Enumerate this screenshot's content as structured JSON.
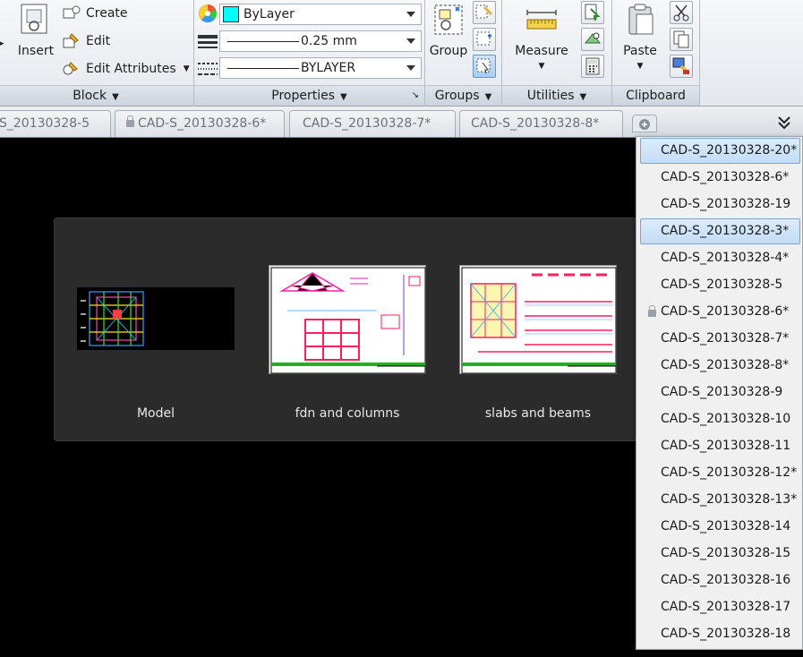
{
  "ribbon": {
    "block": {
      "title": "Block",
      "insert_label": "Insert",
      "create_label": "Create",
      "edit_label": "Edit",
      "edit_attributes_label": "Edit Attributes"
    },
    "properties": {
      "title": "Properties",
      "color_value": "ByLayer",
      "color_swatch": "#00ffff",
      "lineweight_value": "0.25 mm",
      "linetype_value": "BYLAYER"
    },
    "groups": {
      "title": "Groups",
      "group_label": "Group"
    },
    "utilities": {
      "title": "Utilities",
      "measure_label": "Measure"
    },
    "clipboard": {
      "title": "Clipboard",
      "paste_label": "Paste"
    }
  },
  "tabs": [
    {
      "label": "S_20130328-5",
      "locked": false
    },
    {
      "label": "CAD-S_20130328-6*",
      "locked": true
    },
    {
      "label": "CAD-S_20130328-7*",
      "locked": false
    },
    {
      "label": "CAD-S_20130328-8*",
      "locked": false
    }
  ],
  "layout_preview": {
    "items": [
      {
        "label": "Model"
      },
      {
        "label": "fdn and columns"
      },
      {
        "label": "slabs and beams"
      }
    ]
  },
  "drawing_list": {
    "items": [
      {
        "label": "CAD-S_20130328-20*",
        "highlighted": true,
        "locked": false
      },
      {
        "label": "CAD-S_20130328-6*",
        "highlighted": false,
        "locked": false
      },
      {
        "label": "CAD-S_20130328-19",
        "highlighted": false,
        "locked": false
      },
      {
        "label": "CAD-S_20130328-3*",
        "highlighted": true,
        "locked": false
      },
      {
        "label": "CAD-S_20130328-4*",
        "highlighted": false,
        "locked": false
      },
      {
        "label": "CAD-S_20130328-5",
        "highlighted": false,
        "locked": false
      },
      {
        "label": "CAD-S_20130328-6*",
        "highlighted": false,
        "locked": true
      },
      {
        "label": "CAD-S_20130328-7*",
        "highlighted": false,
        "locked": false
      },
      {
        "label": "CAD-S_20130328-8*",
        "highlighted": false,
        "locked": false
      },
      {
        "label": "CAD-S_20130328-9",
        "highlighted": false,
        "locked": false
      },
      {
        "label": "CAD-S_20130328-10",
        "highlighted": false,
        "locked": false
      },
      {
        "label": "CAD-S_20130328-11",
        "highlighted": false,
        "locked": false
      },
      {
        "label": "CAD-S_20130328-12*",
        "highlighted": false,
        "locked": false
      },
      {
        "label": "CAD-S_20130328-13*",
        "highlighted": false,
        "locked": false
      },
      {
        "label": "CAD-S_20130328-14",
        "highlighted": false,
        "locked": false
      },
      {
        "label": "CAD-S_20130328-15",
        "highlighted": false,
        "locked": false
      },
      {
        "label": "CAD-S_20130328-16",
        "highlighted": false,
        "locked": false
      },
      {
        "label": "CAD-S_20130328-17",
        "highlighted": false,
        "locked": false
      },
      {
        "label": "CAD-S_20130328-18",
        "highlighted": false,
        "locked": false
      }
    ]
  }
}
